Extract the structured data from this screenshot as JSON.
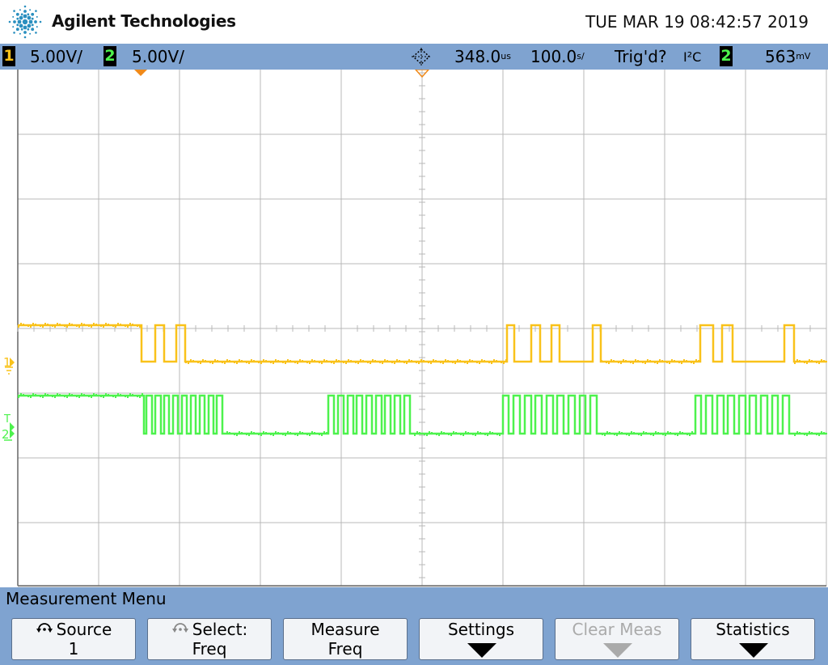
{
  "header": {
    "brand": "Agilent Technologies",
    "datetime": "TUE MAR 19 08:42:57 2019"
  },
  "status": {
    "ch1_num": "1",
    "ch1_scale": "5.00V/",
    "ch2_num": "2",
    "ch2_scale": "5.00V/",
    "time_delay": "348.0",
    "time_delay_unit": "us",
    "time_scale": "100.0",
    "time_scale_unit": "s/",
    "trigger_status": "Trig'd?",
    "trigger_mode": "I²C",
    "trigger_source": "2",
    "trigger_level": "563",
    "trigger_level_unit": "mV"
  },
  "screen": {
    "ch1_marker": "1",
    "ch2_marker": "2",
    "trigger_marker": "T",
    "colors": {
      "ch1": "#f9c21a",
      "ch2": "#4df24d",
      "grid": "#b9b9b9",
      "background": "#ffffff"
    }
  },
  "menu": {
    "title": "Measurement Menu",
    "keys": [
      {
        "line1": "Source",
        "line2": "1",
        "icon": "rotate-knob-icon"
      },
      {
        "line1": "Select:",
        "line2": "Freq",
        "icon": "rotate-knob-icon"
      },
      {
        "line1": "Measure",
        "line2": "Freq"
      },
      {
        "line1": "Settings",
        "line2": "",
        "icon": "submenu-arrow-icon"
      },
      {
        "line1": "Clear Meas",
        "line2": "",
        "icon": "submenu-arrow-icon",
        "disabled": true
      },
      {
        "line1": "Statistics",
        "line2": "",
        "icon": "submenu-arrow-icon"
      }
    ]
  }
}
